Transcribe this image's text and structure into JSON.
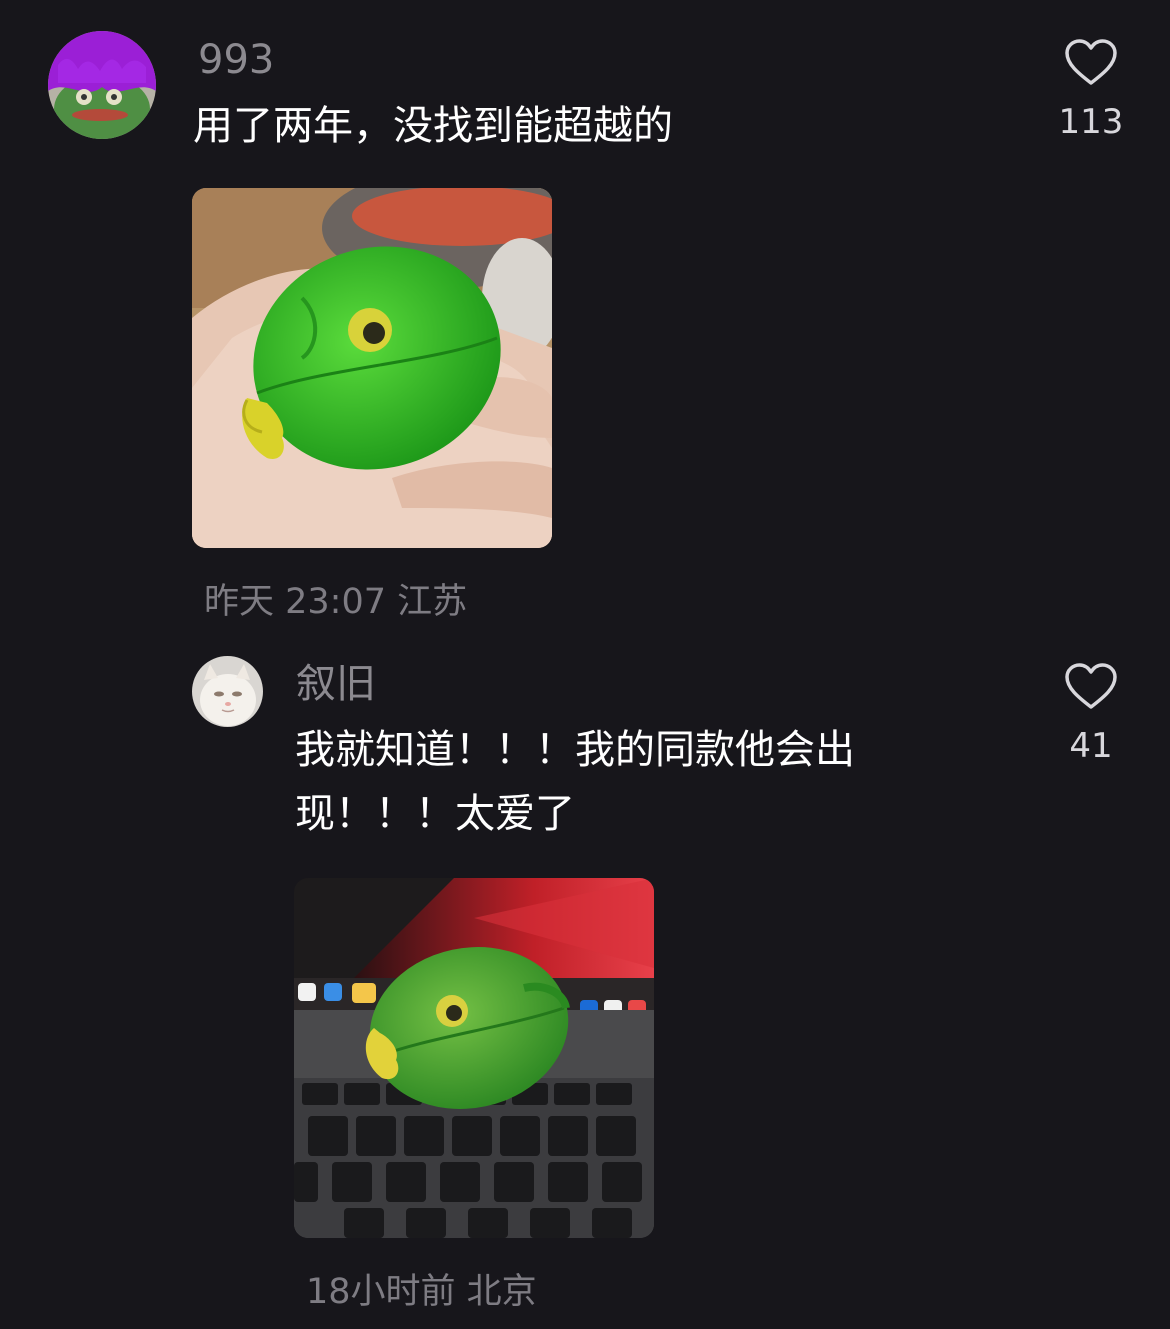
{
  "comments": [
    {
      "username": "993",
      "text": "用了两年，没找到能超越的",
      "time_location": "昨天 23:07 江苏",
      "likes": "113"
    },
    {
      "username": "叙旧",
      "text": "我就知道！！！我的同款他会出现！！！太爱了",
      "time_location": "18小时前 北京",
      "likes": "41"
    }
  ],
  "colors": {
    "background": "#17161b",
    "username": "#8c8a90",
    "meta": "#7e7c83",
    "frog_green": "#3fc22a"
  },
  "icons": [
    "heart-outline-icon"
  ]
}
